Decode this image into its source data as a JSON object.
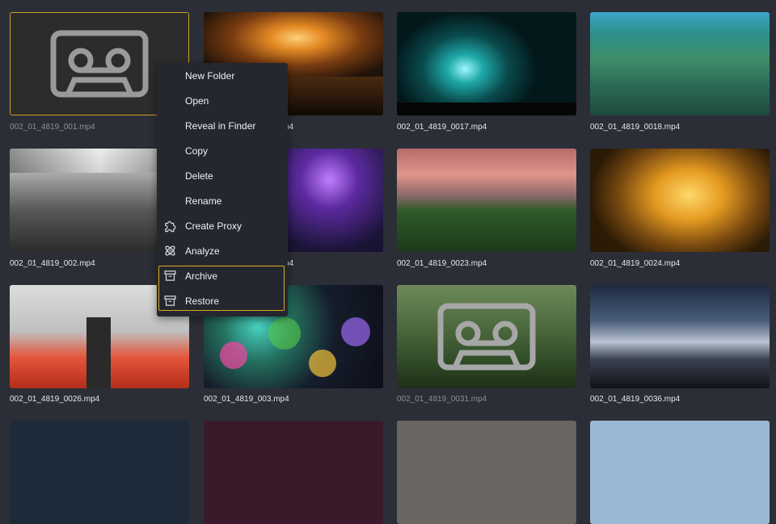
{
  "files": [
    {
      "name": "002_01_4819_001.mp4",
      "thumbnail": "placeholder-tape",
      "selected": true,
      "dimmed": true
    },
    {
      "name": "002_01_4819_0016.mp4",
      "thumbnail": "sunset-clouds"
    },
    {
      "name": "002_01_4819_0017.mp4",
      "thumbnail": "underwater-diver"
    },
    {
      "name": "002_01_4819_0018.mp4",
      "thumbnail": "coral-reef"
    },
    {
      "name": "002_01_4819_002.mp4",
      "thumbnail": "subway-station-bw"
    },
    {
      "name": "002_01_4819_0022.mp4",
      "thumbnail": "city-night-aerial"
    },
    {
      "name": "002_01_4819_0023.mp4",
      "thumbnail": "forest-dusk"
    },
    {
      "name": "002_01_4819_0024.mp4",
      "thumbnail": "atrium-lights"
    },
    {
      "name": "002_01_4819_0026.mp4",
      "thumbnail": "escalator-tunnel"
    },
    {
      "name": "002_01_4819_003.mp4",
      "thumbnail": "bokeh-lights"
    },
    {
      "name": "002_01_4819_0031.mp4",
      "thumbnail": "placeholder-tape",
      "dimmed": true
    },
    {
      "name": "002_01_4819_0036.mp4",
      "thumbnail": "mountain-milky-way"
    },
    {
      "name": "",
      "thumbnail": "night-sky"
    },
    {
      "name": "",
      "thumbnail": "neon-street"
    },
    {
      "name": "",
      "thumbnail": "cloudy-sky"
    },
    {
      "name": "",
      "thumbnail": "blue-sky"
    }
  ],
  "context_menu": {
    "items": [
      {
        "label": "New Folder",
        "icon": ""
      },
      {
        "label": "Open",
        "icon": ""
      },
      {
        "label": "Reveal in Finder",
        "icon": ""
      },
      {
        "label": "Copy",
        "icon": ""
      },
      {
        "label": "Delete",
        "icon": ""
      },
      {
        "label": "Rename",
        "icon": ""
      },
      {
        "label": "Create Proxy",
        "icon": "puzzle-icon"
      },
      {
        "label": "Analyze",
        "icon": "atom-icon"
      },
      {
        "label": "Archive",
        "icon": "archive-box-icon",
        "highlighted": true
      },
      {
        "label": "Restore",
        "icon": "archive-box-icon",
        "highlighted": true
      }
    ]
  },
  "colors": {
    "background": "#2b2e36",
    "menu_background": "#24272f",
    "selection_border": "#c9a227",
    "highlight_border": "#e0a820"
  }
}
